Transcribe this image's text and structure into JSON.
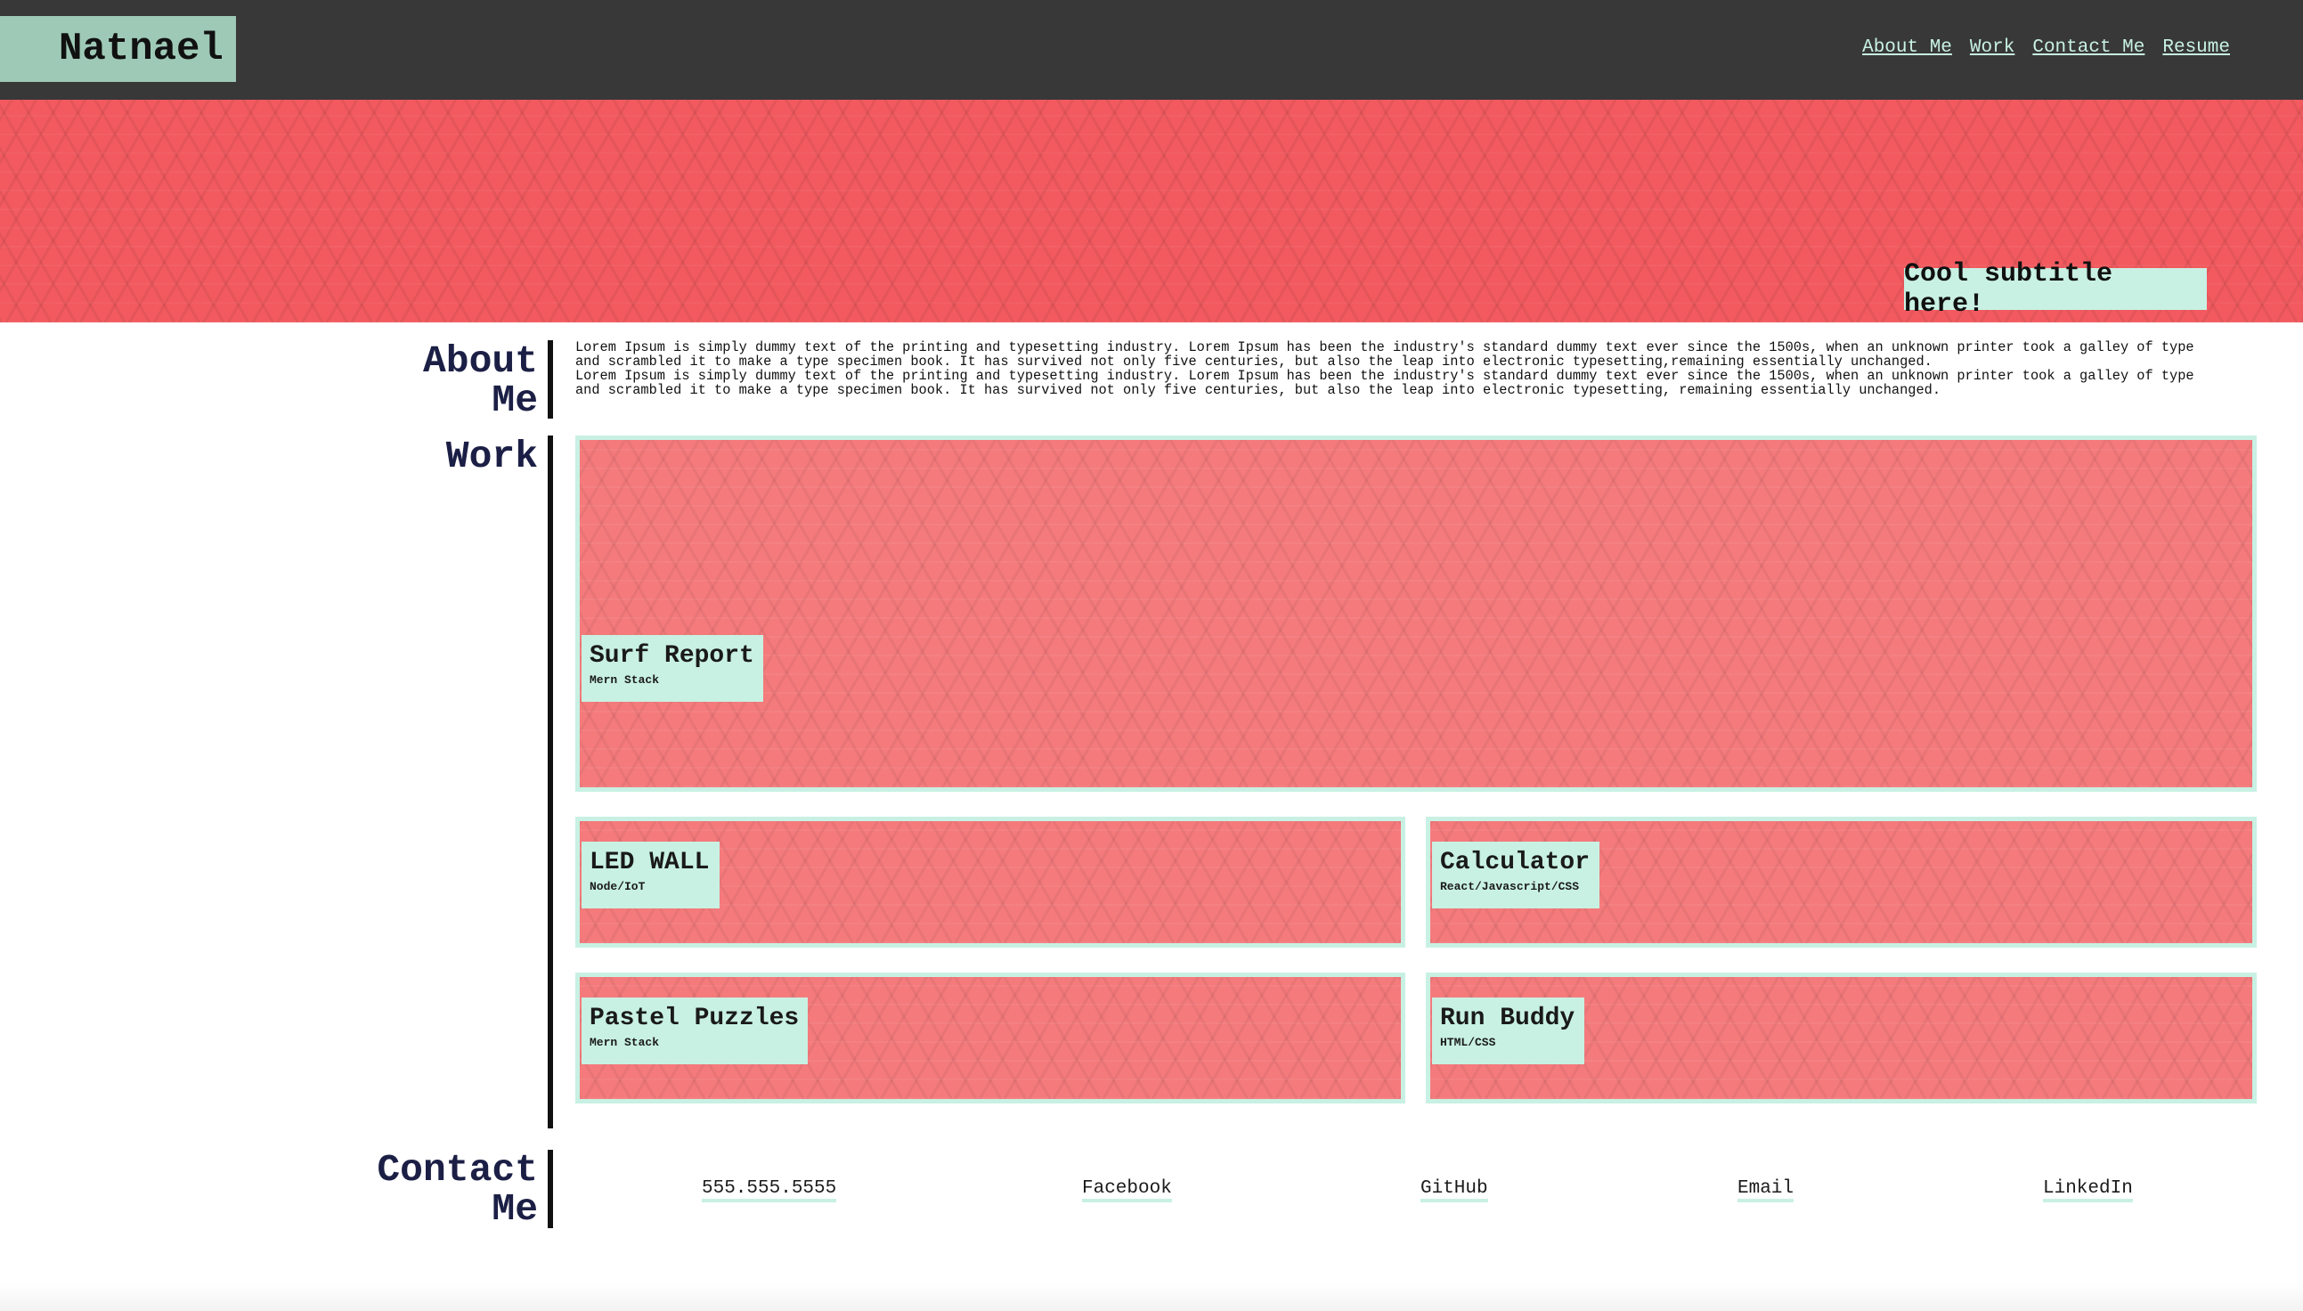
{
  "header": {
    "brand": "Natnael",
    "nav": [
      "About Me",
      "Work",
      "Contact Me",
      "Resume"
    ]
  },
  "hero": {
    "subtitle": "Cool subtitle here!"
  },
  "about": {
    "title_line1": "About",
    "title_line2": "Me",
    "paragraphs": [
      "Lorem Ipsum is simply dummy text of the printing and typesetting industry. Lorem Ipsum has been the industry's standard dummy text ever since the 1500s, when an unknown printer took a galley of type and scrambled it to make a type specimen book. It has survived not only five centuries, but also the leap into electronic typesetting,remaining essentially unchanged.",
      "Lorem Ipsum is simply dummy text of the printing and typesetting industry. Lorem Ipsum has been the industry's standard dummy text ever since the 1500s, when an unknown printer took a galley of type and scrambled it to make a type specimen book. It has survived not only five centuries, but also the leap into electronic typesetting, remaining essentially unchanged."
    ]
  },
  "work": {
    "title": "Work",
    "projects": [
      {
        "title": "Surf Report",
        "stack": "Mern Stack"
      },
      {
        "title": "LED WALL",
        "stack": "Node/IoT"
      },
      {
        "title": "Calculator",
        "stack": "React/Javascript/CSS"
      },
      {
        "title": "Pastel Puzzles",
        "stack": "Mern Stack"
      },
      {
        "title": "Run Buddy",
        "stack": "HTML/CSS"
      }
    ]
  },
  "contact": {
    "title_line1": "Contact",
    "title_line2": "Me",
    "links": [
      "555.555.5555",
      "Facebook",
      "GitHub",
      "Email",
      "LinkedIn"
    ]
  },
  "colors": {
    "header_bg": "#383838",
    "brand_bg": "#9ec9b7",
    "accent_mint": "#c8f1e3",
    "hero_red": "#f25a5f",
    "card_red": "#f47a7c",
    "heading_navy": "#1c1f45"
  }
}
